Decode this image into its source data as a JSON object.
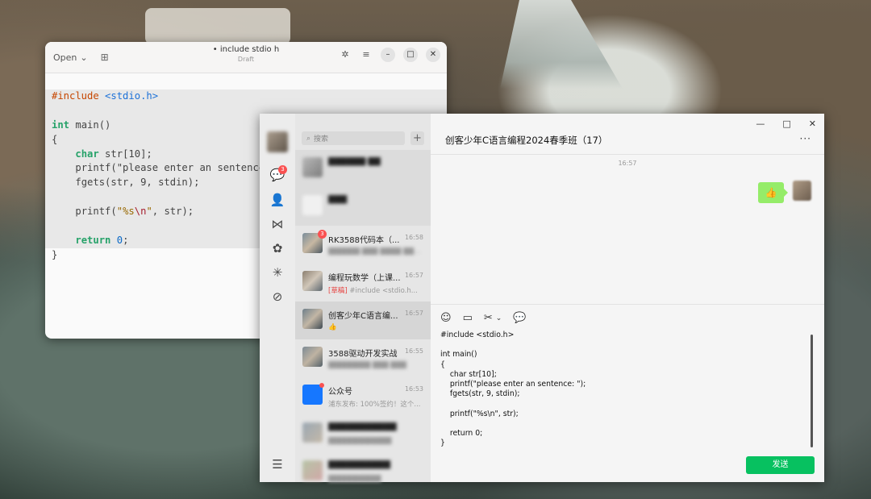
{
  "editor": {
    "open_label": "Open",
    "title": "• include stdio h",
    "subtitle": "Draft",
    "code": {
      "l1_pre": "#include",
      "l1_inc": "<stdio.h>",
      "l3_kw": "int",
      "l3_rest": " main()",
      "l4": "{",
      "l5_kw": "char",
      "l5_rest": " str[10];",
      "l6": "printf(\"please enter an sentence",
      "l7": "fgets(str, 9, stdin);",
      "l9_a": "printf(",
      "l9_s1": "\"%s",
      "l9_esc": "\\n",
      "l9_s2": "\"",
      "l9_b": ", str);",
      "l11_kw": "return",
      "l11_num": "0",
      "l11_end": ";",
      "l12": "}"
    }
  },
  "wechat": {
    "nav_badge": "3",
    "search_placeholder": "搜索",
    "chats": [
      {
        "name": "██████·██",
        "time": "",
        "preview": ""
      },
      {
        "name": "███",
        "time": "",
        "preview": ""
      },
      {
        "name": "RK3588代码本（...",
        "time": "16:58",
        "preview": "██████ ███ ████ ████",
        "badge": "3"
      },
      {
        "name": "编程玩数学（上课...",
        "time": "16:57",
        "draft": "[草稿]",
        "preview": " #include <stdio.h..."
      },
      {
        "name": "创客少年C语言编...",
        "time": "16:57",
        "preview": "👍"
      },
      {
        "name": "3588驱动开发实战",
        "time": "16:55",
        "preview": "████████ ███ ███"
      },
      {
        "name": "公众号",
        "time": "16:53",
        "preview": "浦东发布: 100%签约！这个..."
      },
      {
        "name": "███████████",
        "time": "",
        "preview": "████████████"
      },
      {
        "name": "██████████",
        "time": "",
        "preview": "██████████"
      }
    ],
    "chat_title": "创客少年C语言编程2024春季班（17）",
    "msg_time": "16:57",
    "bubble": "👍",
    "input_text": "#include <stdio.h>\n\nint main()\n{\n    char str[10];\n    printf(\"please enter an sentence: \");\n    fgets(str, 9, stdin);\n\n    printf(\"%s\\n\", str);\n\n    return 0;\n}",
    "send_label": "发送"
  }
}
